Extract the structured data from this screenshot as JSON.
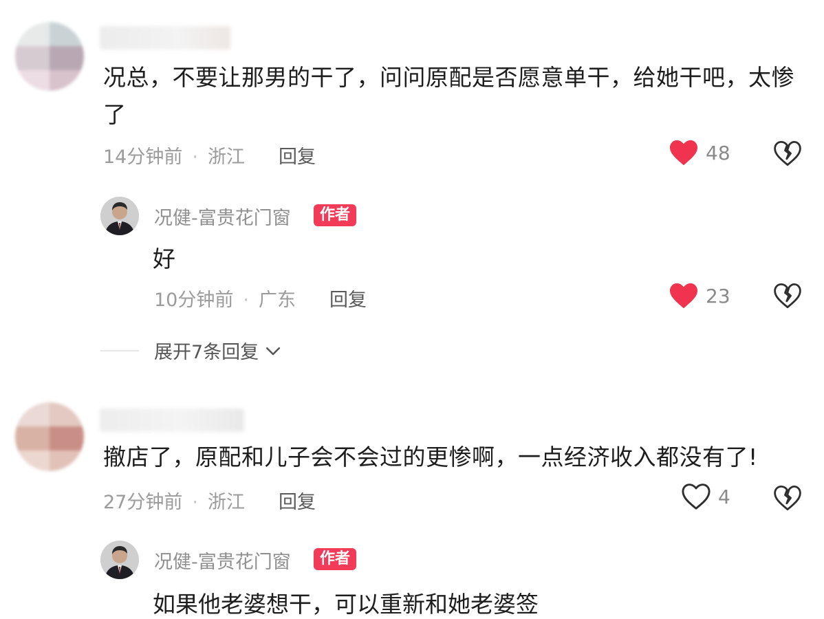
{
  "comments": [
    {
      "text": "况总，不要让那男的干了，问问原配是否愿意单干，给她干吧，太惨了",
      "time": "14分钟前",
      "location": "浙江",
      "reply_label": "回复",
      "likes": "48",
      "liked": true,
      "author_reply": {
        "name": "况健-富贵花门窗",
        "badge": "作者",
        "text": "好",
        "time": "10分钟前",
        "location": "广东",
        "reply_label": "回复",
        "likes": "23",
        "liked": true
      },
      "expand_label": "展开7条回复"
    },
    {
      "text": "撤店了，原配和儿子会不会过的更惨啊，一点经济收入都没有了!",
      "time": "27分钟前",
      "location": "浙江",
      "reply_label": "回复",
      "likes": "4",
      "liked": false,
      "author_reply": {
        "name": "况健-富贵花门窗",
        "badge": "作者",
        "text": "如果他老婆想干，可以重新和她老婆签"
      }
    }
  ],
  "colors": {
    "like_red": "#f0334f",
    "badge_red": "#f23b59",
    "meta_gray": "#9b9b9b"
  },
  "icons": {
    "like": "heart-icon",
    "dislike": "broken-heart-icon",
    "expand": "chevron-down-icon"
  }
}
